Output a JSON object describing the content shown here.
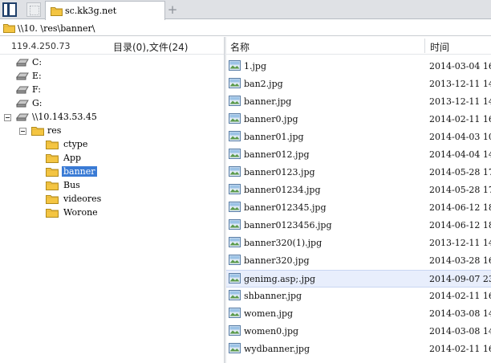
{
  "tabs": [
    {
      "label": "sc.kk3g.net",
      "icon": "folder-icon"
    }
  ],
  "address": {
    "path": "\\\\10.          \\res\\banner\\"
  },
  "left_panel": {
    "ip": "119.4.250.73",
    "counts": "目录(0),文件(24)"
  },
  "tree": {
    "drives": [
      "C:",
      "E:",
      "F:",
      "G:"
    ],
    "network": "\\\\10.143.53.45",
    "res": "res",
    "folders": [
      "ctype",
      "App",
      "banner",
      "Bus",
      "videores",
      "Worone"
    ],
    "selected": "banner"
  },
  "file_list": {
    "columns": {
      "name": "名称",
      "time": "时间"
    },
    "files": [
      {
        "name": "1.jpg",
        "time": "2014-03-04 16"
      },
      {
        "name": "ban2.jpg",
        "time": "2013-12-11 14"
      },
      {
        "name": "banner.jpg",
        "time": "2013-12-11 14"
      },
      {
        "name": "banner0.jpg",
        "time": "2014-02-11 16"
      },
      {
        "name": "banner01.jpg",
        "time": "2014-04-03 10"
      },
      {
        "name": "banner012.jpg",
        "time": "2014-04-04 14"
      },
      {
        "name": "banner0123.jpg",
        "time": "2014-05-28 17"
      },
      {
        "name": "banner01234.jpg",
        "time": "2014-05-28 17"
      },
      {
        "name": "banner012345.jpg",
        "time": "2014-06-12 18"
      },
      {
        "name": "banner0123456.jpg",
        "time": "2014-06-12 18"
      },
      {
        "name": "banner320(1).jpg",
        "time": "2013-12-11 14"
      },
      {
        "name": "banner320.jpg",
        "time": "2014-03-28 16"
      },
      {
        "name": "genimg.asp;.jpg",
        "time": "2014-09-07 23"
      },
      {
        "name": "shbanner.jpg",
        "time": "2014-02-11 16"
      },
      {
        "name": "women.jpg",
        "time": "2014-03-08 14"
      },
      {
        "name": "women0.jpg",
        "time": "2014-03-08 14"
      },
      {
        "name": "wydbanner.jpg",
        "time": "2014-02-11 16"
      }
    ],
    "selected_index": 12
  },
  "colors": {
    "selection": "#3a7bd5",
    "row_highlight": "#e8eefc",
    "folder": "#f4c542"
  }
}
